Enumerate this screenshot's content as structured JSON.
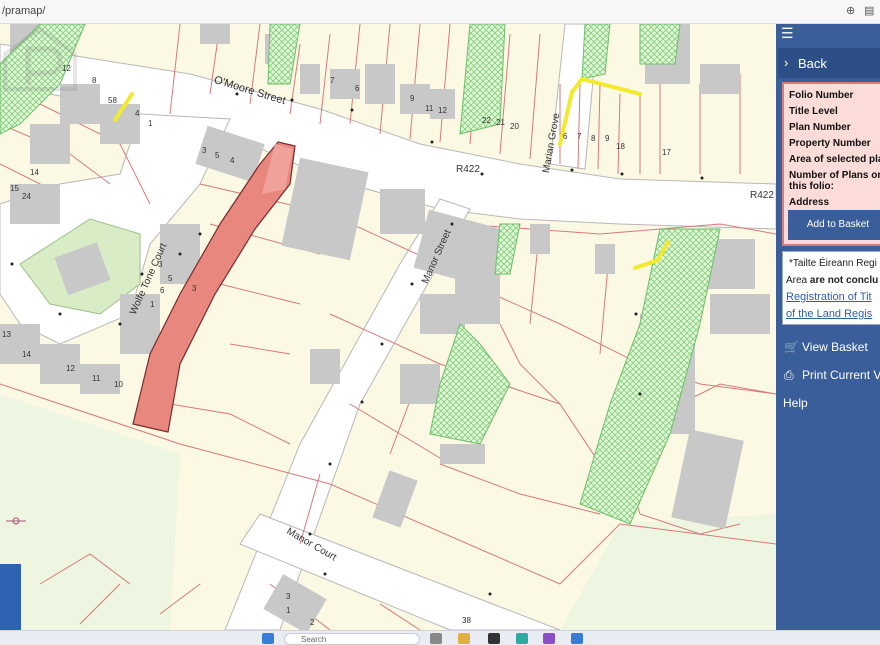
{
  "browser": {
    "url": "/pramap/"
  },
  "map": {
    "streets": {
      "omoore": "O'Moore Street",
      "manor": "Manor Street",
      "marian": "Marian Grove",
      "wolfe": "Wolfe Tone Court",
      "manor_court": "Manor Court",
      "r422_a": "R422",
      "r422_b": "R422"
    },
    "house_numbers": {
      "a": "12",
      "b": "8",
      "c": "58",
      "d": "4",
      "e": "1",
      "f": "3",
      "g": "5",
      "h": "6",
      "i": "7",
      "j": "9",
      "k": "11",
      "l": "12",
      "m": "20",
      "n": "21",
      "o": "22",
      "p": "6",
      "q": "7",
      "r": "8",
      "s": "9",
      "t": "18",
      "u": "17",
      "v": "4",
      "w": "3",
      "x": "14",
      "y": "15",
      "z": "24",
      "aa": "13",
      "bb": "14",
      "cc": "11",
      "dd": "10",
      "ee": "12",
      "ff": "3",
      "gg": "1",
      "hh": "2",
      "ii": "5",
      "jj": "6",
      "kk": "3",
      "ll": "38",
      "mm": "1"
    }
  },
  "panel": {
    "back_label": "Back",
    "info": {
      "folio_number": "Folio Number",
      "title_level": "Title Level",
      "plan_number": "Plan Number",
      "property_number": "Property Number",
      "area_selected": "Area of selected pla",
      "number_of_plans_1": "Number of Plans on",
      "number_of_plans_2": "this folio:",
      "address": "Address"
    },
    "add_to_basket": "Add to Basket",
    "note": {
      "line1": "*Tailte Éireann Regi",
      "line2_prefix": "Area ",
      "line2_bold": "are not conclu",
      "link1": "Registration of Tit",
      "link2": "of the Land Regis"
    },
    "menu": {
      "view_basket": "View Basket",
      "print_view": "Print Current V",
      "help": "Help"
    }
  },
  "taskbar": {
    "search_placeholder": "Search"
  },
  "colors": {
    "panel_bg": "#3a5e9a",
    "selected_plot": "#e8877e",
    "road": "#ffffff",
    "land": "#fbf8e3",
    "building": "#c8c8c8",
    "boundary": "#d06060",
    "green_hatch": "#7fcf7a",
    "yellow_highlight": "#f2ea2c"
  }
}
